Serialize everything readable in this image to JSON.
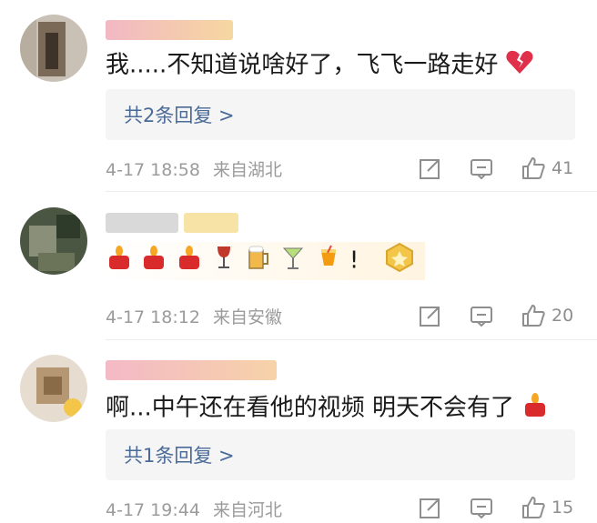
{
  "comments": [
    {
      "text": "我.....不知道说啥好了，飞飞一路走好",
      "reply_link": "共2条回复 >",
      "time": "4-17 18:58",
      "location": "来自湖北",
      "likes": "41",
      "icons": [
        "broken-heart-icon"
      ]
    },
    {
      "text": "!",
      "time": "4-17 18:12",
      "location": "来自安徽",
      "likes": "20",
      "icons": [
        "candle-icon",
        "candle-icon",
        "candle-icon",
        "wine-glass-icon",
        "beer-mug-icon",
        "cocktail-glass-icon",
        "tropical-drink-icon",
        "gold-badge-icon"
      ]
    },
    {
      "text": "啊...中午还在看他的视频 明天不会有了",
      "reply_link": "共1条回复 >",
      "time": "4-17 19:44",
      "location": "来自河北",
      "likes": "15",
      "icons": [
        "candle-icon"
      ]
    }
  ],
  "colors": {
    "link": "#4a6a98",
    "meta": "#9b9b9b",
    "reply_bg": "#f5f5f5"
  }
}
